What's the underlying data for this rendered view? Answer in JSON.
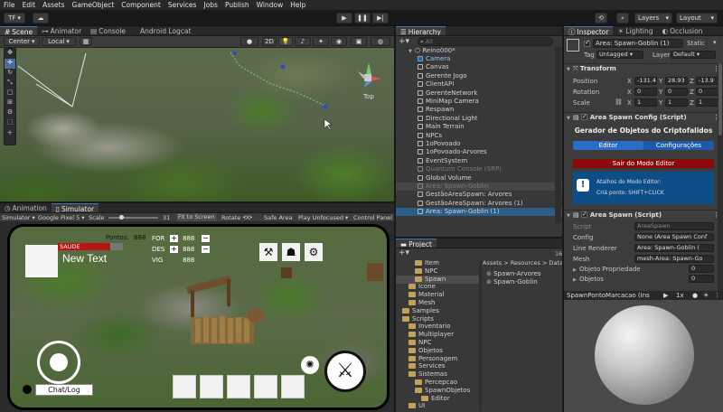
{
  "menu": [
    "File",
    "Edit",
    "Assets",
    "GameObject",
    "Component",
    "Services",
    "Jobs",
    "Publish",
    "Window",
    "Help"
  ],
  "toolbar": {
    "account": "TF",
    "layers": "Layers",
    "layout": "Layout"
  },
  "scene_tabs": {
    "scene": "Scene",
    "animator": "Animator",
    "console": "Console",
    "logcat": "Android Logcat"
  },
  "scene_toolbar": {
    "pivot": "Center",
    "space": "Local",
    "mode2d": "2D"
  },
  "scene_view": {
    "persp_label": "Top"
  },
  "sim_tabs": {
    "animation": "Animation",
    "simulator": "Simulator"
  },
  "sim_toolbar": {
    "mode": "Simulator",
    "device": "Google Pixel 5",
    "scale_label": "Scale",
    "scale_value": "31",
    "fit": "Fit to Screen",
    "rotate": "Rotate",
    "safe_area": "Safe Area",
    "play_mode": "Play Unfocused",
    "panel": "Control Panel"
  },
  "game_hud": {
    "health_label": "SAUDE",
    "points_label": "Pontos:",
    "points_value": "888",
    "name": "New Text",
    "stats": [
      {
        "label": "FOR",
        "value": "888"
      },
      {
        "label": "DES",
        "value": "888"
      },
      {
        "label": "VIG",
        "value": "888"
      }
    ],
    "chat_button": "Chat/Log"
  },
  "hierarchy": {
    "title": "Hierarchy",
    "search_placeholder": "All",
    "scene_name": "Reino000*",
    "items": [
      {
        "label": "Camera",
        "indent": 1,
        "selected": false,
        "color": "#5fa8ee"
      },
      {
        "label": "Canvas",
        "indent": 1
      },
      {
        "label": "Gerente Jogo",
        "indent": 1
      },
      {
        "label": "ClientAPI",
        "indent": 1
      },
      {
        "label": "GerenteNetwork",
        "indent": 1
      },
      {
        "label": "MiniMap Camera",
        "indent": 1
      },
      {
        "label": "Respawn",
        "indent": 1
      },
      {
        "label": "Directional Light",
        "indent": 1
      },
      {
        "label": "Main Terrain",
        "indent": 1
      },
      {
        "label": "NPCs",
        "indent": 1
      },
      {
        "label": "1oPovoado",
        "indent": 1
      },
      {
        "label": "1oPovoado-Arvores",
        "indent": 1
      },
      {
        "label": "EventSystem",
        "indent": 1
      },
      {
        "label": "Quantum Console (SRP)",
        "indent": 1,
        "dim": true
      },
      {
        "label": "Global Volume",
        "indent": 1
      },
      {
        "label": "Area: Spawn-Goblin",
        "indent": 1,
        "dim": true,
        "hover": true
      },
      {
        "label": "GestãoAreaSpawn: Arvores",
        "indent": 1
      },
      {
        "label": "GestãoAreaSpawn: Arvores (1)",
        "indent": 1
      },
      {
        "label": "Area: Spawn-Goblin (1)",
        "indent": 1,
        "selected": true
      }
    ]
  },
  "project": {
    "title": "Project",
    "count": "16",
    "tree": [
      {
        "label": "Item",
        "indent": 3
      },
      {
        "label": "NPC",
        "indent": 3
      },
      {
        "label": "Spawn",
        "indent": 3,
        "selected": true
      },
      {
        "label": "Icone",
        "indent": 2
      },
      {
        "label": "Material",
        "indent": 2
      },
      {
        "label": "Mesh",
        "indent": 2
      },
      {
        "label": "Samples",
        "indent": 1
      },
      {
        "label": "Scripts",
        "indent": 1
      },
      {
        "label": "Inventario",
        "indent": 2
      },
      {
        "label": "Multiplayer",
        "indent": 2
      },
      {
        "label": "NPC",
        "indent": 2
      },
      {
        "label": "Objetos",
        "indent": 2
      },
      {
        "label": "Personagem",
        "indent": 2
      },
      {
        "label": "Services",
        "indent": 2
      },
      {
        "label": "Sistemas",
        "indent": 2
      },
      {
        "label": "Percepcao",
        "indent": 3
      },
      {
        "label": "SpawnObjetos",
        "indent": 3
      },
      {
        "label": "Editor",
        "indent": 4
      },
      {
        "label": "UI",
        "indent": 2
      }
    ],
    "breadcrumb": [
      "Assets",
      "Resources",
      "Data"
    ],
    "files": [
      "Spawn-Arvores",
      "Spawn-Goblin"
    ]
  },
  "inspector": {
    "tabs": {
      "inspector": "Inspector",
      "lighting": "Lighting",
      "occlusion": "Occlusion"
    },
    "object_name": "Area: Spawn-Goblin (1)",
    "static": "Static",
    "tag_label": "Tag",
    "tag_value": "Untagged",
    "layer_label": "Layer",
    "layer_value": "Default",
    "transform": {
      "title": "Transform",
      "position": {
        "label": "Position",
        "x": "-131.4",
        "y": "28.93",
        "z": "-13.9"
      },
      "rotation": {
        "label": "Rotation",
        "x": "0",
        "y": "0",
        "z": "0"
      },
      "scale": {
        "label": "Scale",
        "x": "1",
        "y": "1",
        "z": "1"
      }
    },
    "config": {
      "title": "Area Spawn Config (Script)",
      "header": "Gerador de Objetos do Criptofalidos",
      "tab_editor": "Editor",
      "tab_config": "Configurações",
      "exit_button": "Sair do Modo Editor",
      "info_title": "Atalhos do Modo Editor:",
      "info_text": "Criá ponto: SHIFT+CLICK"
    },
    "area_spawn": {
      "title": "Area Spawn (Script)",
      "script_label": "Script",
      "script_value": "AreaSpawn",
      "config_label": "Config",
      "config_value": "None (Area Spawn Conf",
      "line_label": "Line Renderer",
      "line_value": "Area: Spawn-Goblin (",
      "mesh_label": "Mesh",
      "mesh_value": "mesh-Area: Spawn-Go",
      "prop_label": "Objeto Propriedade",
      "prop_value": "0",
      "objs_label": "Objetos",
      "objs_value": "0"
    },
    "preview_title": "SpawnPontoMarcacao (Ins"
  }
}
